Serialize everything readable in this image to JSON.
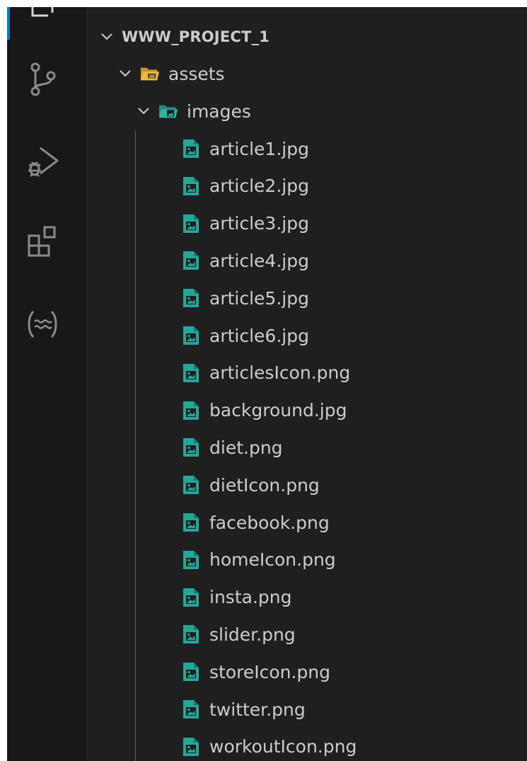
{
  "activity_bar": {
    "icons": [
      "explorer-icon",
      "source-control-icon",
      "run-debug-icon",
      "extensions-icon",
      "remote-icon"
    ],
    "accent_color": "#0078d4"
  },
  "explorer": {
    "root": {
      "label": "WWW_PROJECT_1",
      "expanded": true
    },
    "folders": [
      {
        "label": "assets",
        "expanded": true,
        "icon": "assets-folder-icon",
        "color": "#e8b13c"
      },
      {
        "label": "images",
        "expanded": true,
        "icon": "images-folder-icon",
        "color": "#33b5a6"
      }
    ],
    "files": [
      {
        "label": "article1.jpg"
      },
      {
        "label": "article2.jpg"
      },
      {
        "label": "article3.jpg"
      },
      {
        "label": "article4.jpg"
      },
      {
        "label": "article5.jpg"
      },
      {
        "label": "article6.jpg"
      },
      {
        "label": "articlesIcon.png"
      },
      {
        "label": "background.jpg"
      },
      {
        "label": "diet.png"
      },
      {
        "label": "dietIcon.png"
      },
      {
        "label": "facebook.png"
      },
      {
        "label": "homeIcon.png"
      },
      {
        "label": "insta.png"
      },
      {
        "label": "slider.png"
      },
      {
        "label": "storeIcon.png"
      },
      {
        "label": "twitter.png"
      },
      {
        "label": "workoutIcon.png"
      }
    ],
    "file_icon": "image-file-icon",
    "file_icon_color": "#26a69a"
  }
}
